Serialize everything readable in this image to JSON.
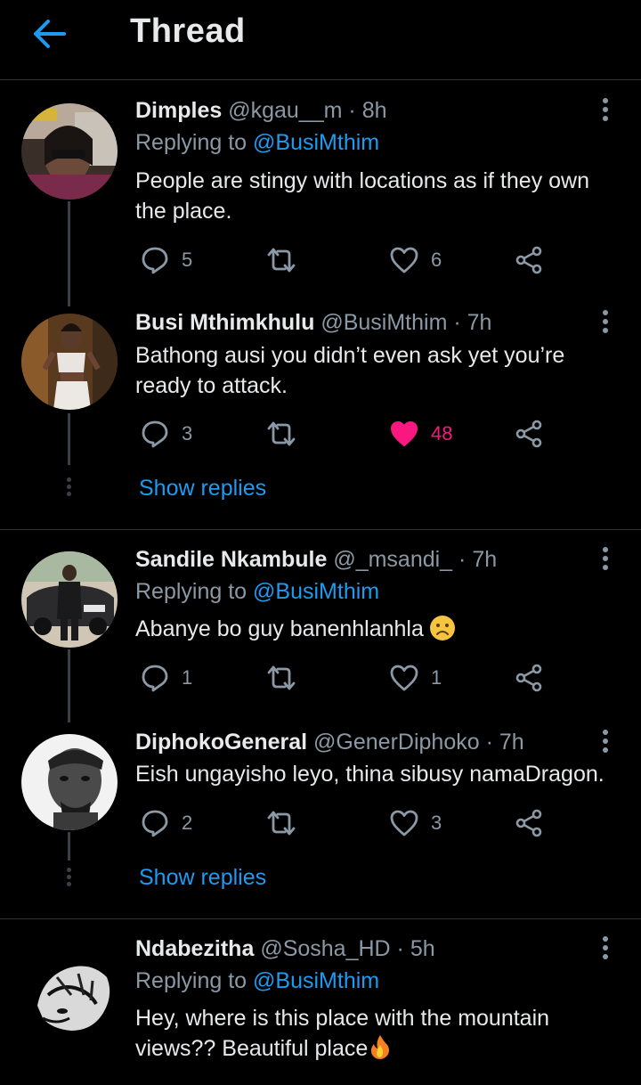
{
  "header": {
    "title": "Thread"
  },
  "tweets": [
    {
      "name": "Dimples",
      "handle": "@kgau__m",
      "time": "8h",
      "replying_prefix": "Replying to ",
      "replying_to": "@BusiMthim",
      "text": "People are stingy with locations as if they own the place.",
      "replies": "5",
      "likes": "6",
      "liked": false
    },
    {
      "name": "Busi Mthimkhulu",
      "handle": "@BusiMthim",
      "time": "7h",
      "text": "Bathong ausi you didn’t even ask yet you’re ready to attack.",
      "replies": "3",
      "likes": "48",
      "liked": true
    },
    {
      "name": "Sandile Nkambule",
      "handle": "@_msandi_",
      "time": "7h",
      "replying_prefix": "Replying to ",
      "replying_to": "@BusiMthim",
      "text": "Abanye bo guy banenhlanhla",
      "replies": "1",
      "likes": "1",
      "liked": false
    },
    {
      "name": "DiphokoGeneral",
      "handle": "@GenerDiphoko",
      "time": "7h",
      "text": "Eish ungayisho leyo, thina sibusy namaDragon.",
      "replies": "2",
      "likes": "3",
      "liked": false
    },
    {
      "name": "Ndabezitha",
      "handle": "@Sosha_HD",
      "time": "5h",
      "replying_prefix": "Replying to ",
      "replying_to": "@BusiMthim",
      "text": "Hey, where is this place with the mountain views?? Beautiful place"
    }
  ],
  "show_replies_label": "Show replies",
  "separator": "·",
  "colors": {
    "background": "#000000",
    "accent": "#1d9bf0",
    "like": "#f91880",
    "muted": "#8b98a5",
    "text": "#e7e9ea"
  }
}
